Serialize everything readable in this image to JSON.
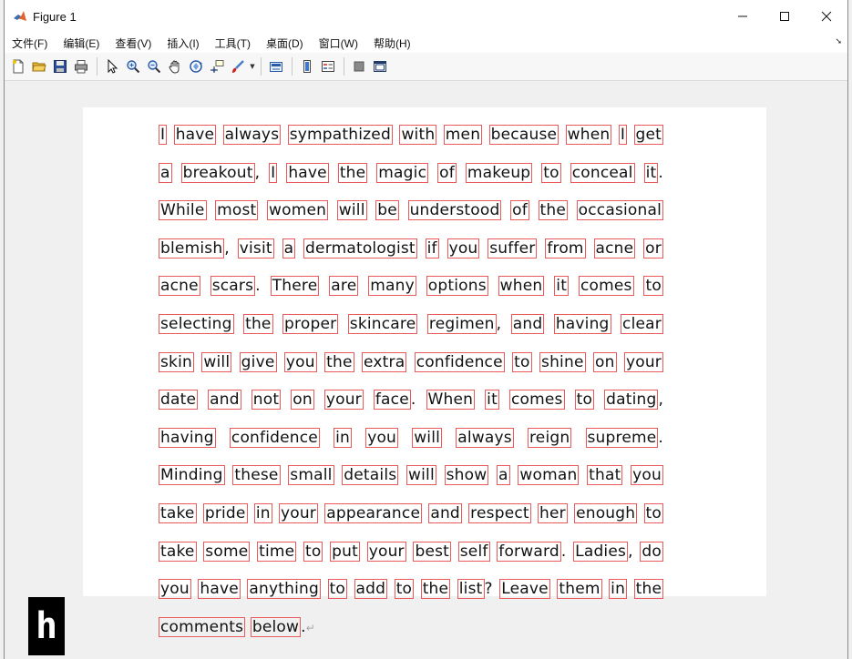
{
  "window": {
    "title": "Figure 1",
    "controls": {
      "minimize": "minimize-icon",
      "maximize": "maximize-icon",
      "close": "close-icon"
    }
  },
  "menu": [
    "文件(F)",
    "编辑(E)",
    "查看(V)",
    "插入(I)",
    "工具(T)",
    "桌面(D)",
    "窗口(W)",
    "帮助(H)"
  ],
  "toolbar": {
    "icons": [
      "new-figure-icon",
      "open-file-icon",
      "save-icon",
      "print-icon",
      "pointer-icon",
      "zoom-in-icon",
      "zoom-out-icon",
      "pan-icon",
      "rotate-3d-icon",
      "data-cursor-icon",
      "brush-icon",
      "link-plot-icon",
      "colorbar-icon",
      "legend-icon",
      "hide-plot-tools-icon",
      "show-plot-tools-icon"
    ]
  },
  "figure": {
    "lines": [
      [
        "I",
        "have",
        "always",
        "sympathized",
        "with",
        "men",
        "because",
        "when",
        "I",
        "get",
        "a"
      ],
      [
        "breakout",
        ",",
        "I",
        "have",
        "the",
        "magic",
        "of",
        "makeup",
        "to",
        "conceal",
        "it",
        ".",
        "While"
      ],
      [
        "most",
        "women",
        "will",
        "be",
        "understood",
        "of",
        "the",
        "occasional",
        "blemish",
        ","
      ],
      [
        "visit",
        "a",
        "dermatologist",
        "if",
        "you",
        "suffer",
        "from",
        "acne",
        "or",
        "acne",
        "scars",
        "."
      ],
      [
        "There",
        "are",
        "many",
        "options",
        "when",
        "it",
        "comes",
        "to",
        "selecting",
        "the",
        "proper"
      ],
      [
        "skincare",
        "regimen",
        ",",
        "and",
        "having",
        "clear",
        "skin",
        "will",
        "give",
        "you",
        "the",
        "extra"
      ],
      [
        "confidence",
        "to",
        "shine",
        "on",
        "your",
        "date",
        "and",
        "not",
        "on",
        "your",
        "face",
        ".",
        "When"
      ],
      [
        "it",
        "comes",
        "to",
        "dating",
        ",",
        "having",
        "confidence",
        "in",
        "you",
        "will",
        "always",
        "reign"
      ],
      [
        "supreme",
        ".",
        "Minding",
        "these",
        "small",
        "details",
        "will",
        "show",
        "a",
        "woman",
        "that"
      ],
      [
        "you",
        "take",
        "pride",
        "in",
        "your",
        "appearance",
        "and",
        "respect",
        "her",
        "enough",
        "to"
      ],
      [
        "take",
        "some",
        "time",
        "to",
        "put",
        "your",
        "best",
        "self",
        "forward",
        ".",
        "Ladies",
        ",",
        "do",
        "you"
      ],
      [
        "have",
        "anything",
        "to",
        "add",
        "to",
        "the",
        "list",
        "?",
        "Leave",
        "them",
        "in",
        "the",
        "comments"
      ],
      [
        "below",
        "."
      ]
    ],
    "box_color": "#ea5a5a",
    "paragraph_mark": "↵"
  },
  "badge": {
    "letter": "h"
  }
}
